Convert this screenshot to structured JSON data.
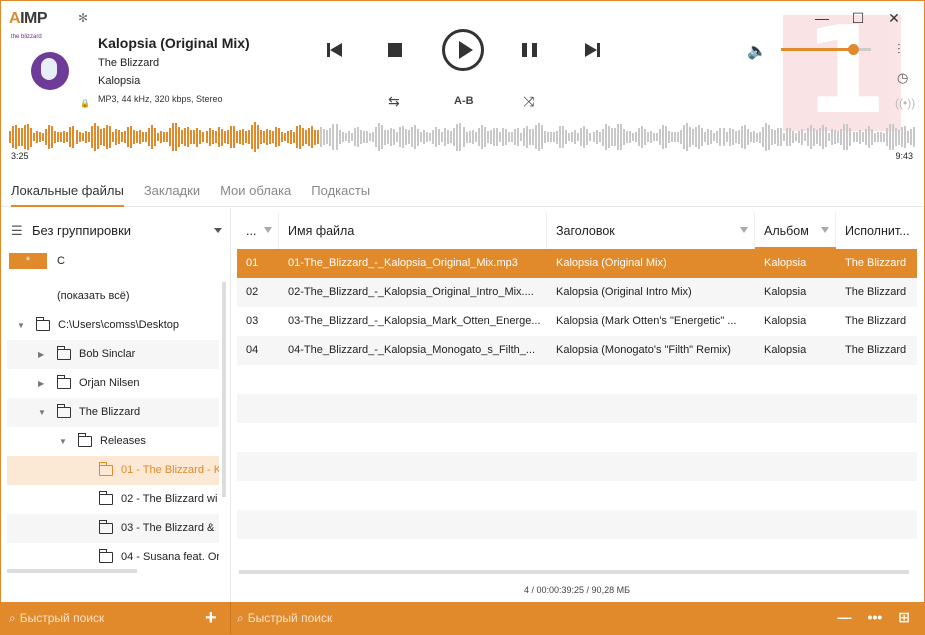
{
  "app": {
    "logo_prefix": "A",
    "logo_rest": "IMP"
  },
  "window_controls": {
    "minimize": "—",
    "maximize": "☐",
    "close": "✕"
  },
  "cover": {
    "brand_text": "the blizzard"
  },
  "track": {
    "title": "Kalopsia (Original Mix)",
    "artist": "The Blizzard",
    "album": "Kalopsia",
    "format": "MP3, 44 kHz, 320 kbps, Stereo"
  },
  "controls": {
    "ab_label": "A-B",
    "repeat_icon": "⇆",
    "shuffle_icon": "⤨"
  },
  "volume": {
    "level": 0.8
  },
  "badge_text": "1",
  "waveform": {
    "progress": 0.34,
    "time_elapsed": "3:25",
    "time_total": "9:43"
  },
  "colors": {
    "accent": "#e08a2c",
    "wave_played": "#e08a2c",
    "wave_rest": "#c8c8c8"
  },
  "tabs": [
    {
      "label": "Локальные файлы",
      "active": true
    },
    {
      "label": "Закладки",
      "active": false
    },
    {
      "label": "Мои облака",
      "active": false
    },
    {
      "label": "Подкасты",
      "active": false
    }
  ],
  "left": {
    "grouping": "Без группировки",
    "star": "*",
    "drive": "C",
    "show_all": "(показать всё)",
    "tree": [
      {
        "label": "C:\\Users\\comss\\Desktop",
        "caret": "▼",
        "level": 0,
        "folder": true
      },
      {
        "label": "Bob Sinclar",
        "caret": "▶",
        "level": 1,
        "folder": true
      },
      {
        "label": "Orjan Nilsen",
        "caret": "▶",
        "level": 1,
        "folder": true
      },
      {
        "label": "The Blizzard",
        "caret": "▼",
        "level": 1,
        "folder": true
      },
      {
        "label": "Releases",
        "caret": "▼",
        "level": 2,
        "folder": true
      },
      {
        "label": "01 - The Blizzard - K",
        "caret": "",
        "level": 3,
        "folder": true,
        "selected": true
      },
      {
        "label": "02 - The Blizzard wi",
        "caret": "",
        "level": 3,
        "folder": true
      },
      {
        "label": "03 - The Blizzard &",
        "caret": "",
        "level": 3,
        "folder": true
      },
      {
        "label": "04 - Susana feat. Or",
        "caret": "",
        "level": 3,
        "folder": true
      }
    ]
  },
  "playlist": {
    "columns": [
      "...",
      "Имя файла",
      "Заголовок",
      "Альбом",
      "Исполнит..."
    ],
    "rows": [
      [
        "01",
        "01-The_Blizzard_-_Kalopsia_Original_Mix.mp3",
        "Kalopsia (Original Mix)",
        "Kalopsia",
        "The Blizzard"
      ],
      [
        "02",
        "02-The_Blizzard_-_Kalopsia_Original_Intro_Mix....",
        "Kalopsia (Original Intro Mix)",
        "Kalopsia",
        "The Blizzard"
      ],
      [
        "03",
        "03-The_Blizzard_-_Kalopsia_Mark_Otten_Energe...",
        "Kalopsia (Mark Otten's \"Energetic\" ...",
        "Kalopsia",
        "The Blizzard"
      ],
      [
        "04",
        "04-The_Blizzard_-_Kalopsia_Monogato_s_Filth_...",
        "Kalopsia (Monogato's \"Filth\" Remix)",
        "Kalopsia",
        "The Blizzard"
      ]
    ],
    "status": "4 / 00:00:39:25 / 90,28 МБ"
  },
  "bottom": {
    "search_left": "Быстрый поиск",
    "search_right": "Быстрый поиск",
    "plus": "+",
    "icons": [
      "—",
      "•••",
      "⊞"
    ]
  }
}
